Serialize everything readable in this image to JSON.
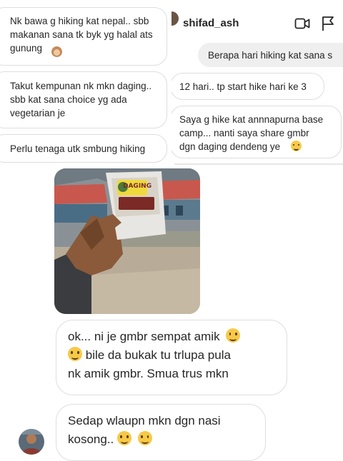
{
  "left_chat": {
    "messages": [
      "Nk bawa g hiking kat nepal.. sbb\nmakanan sana tk byk yg halal ats\ngunung",
      "Takut kempunan nk mkn daging..\nsbb kat sana choice yg ada\nvegetarian je",
      "Perlu tenaga utk smbung hiking"
    ],
    "emoji_1": "see-no-evil-monkey-emoji"
  },
  "right_chat": {
    "username": "shifad_ash",
    "icons": [
      "video-call-icon",
      "flag-icon"
    ],
    "outgoing_message": "Berapa hari hiking kat sana s",
    "replies": [
      "12 hari.. tp start hike hari ke 3",
      "Saya g hike kat annnapurna base\ncamp... nanti saya share gmbr\ndgn daging dendeng ye"
    ],
    "reply_emoji": "grinning-squinting-face-emoji"
  },
  "photo": {
    "package_label": "DAGING"
  },
  "main_chat": {
    "messages": [
      {
        "lines": [
          "ok... ni je gmbr sempat amik",
          " bile da bukak tu trlupa pula",
          "nk amik gmbr. Smua trus mkn"
        ]
      },
      {
        "lines": [
          "Sedap wlaupn mkn dgn nasi",
          "kosong.. "
        ]
      }
    ],
    "emoji_laugh": "grinning-squinting-face-emoji",
    "emoji_smile": "smiling-face-emoji"
  },
  "colors": {
    "bubble_border": "#dedede",
    "outgoing_bubble": "#efefef",
    "text": "#262626",
    "emoji_yellow": "#f7c948"
  }
}
